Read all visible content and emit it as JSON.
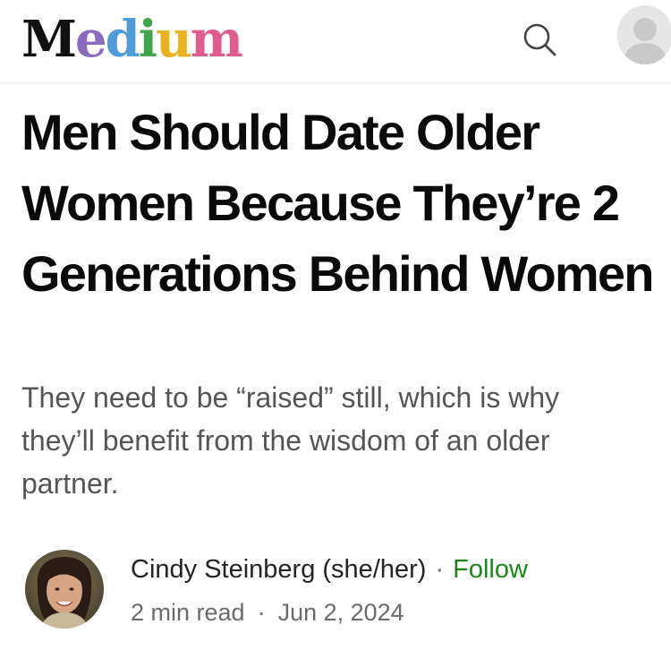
{
  "header": {
    "logo": {
      "letters": [
        {
          "char": "M",
          "color": "#111111"
        },
        {
          "char": "e",
          "color": "#8a6bbf"
        },
        {
          "char": "d",
          "color": "#4f9ad8"
        },
        {
          "char": "i",
          "color": "#3fa44a"
        },
        {
          "char": "u",
          "color": "#e9b21f"
        },
        {
          "char": "m",
          "color": "#e05c8e"
        }
      ]
    },
    "search_icon": "search-icon",
    "avatar_icon": "user-avatar-icon"
  },
  "article": {
    "title": "Men Should Date Older Women Because They’re 2 Generations Behind Women",
    "subtitle": "They need to be “raised” still, which is why they’ll benefit from the wisdom of an older partner."
  },
  "author": {
    "name": "Cindy Steinberg (she/her)",
    "separator": "·",
    "follow_label": "Follow",
    "read_time": "2 min read",
    "meta_separator": "·",
    "date": "Jun 2, 2024"
  },
  "colors": {
    "follow": "#1a8917",
    "title": "#0a0a0a",
    "subtitle": "#555555",
    "meta": "#6b6b6b"
  }
}
